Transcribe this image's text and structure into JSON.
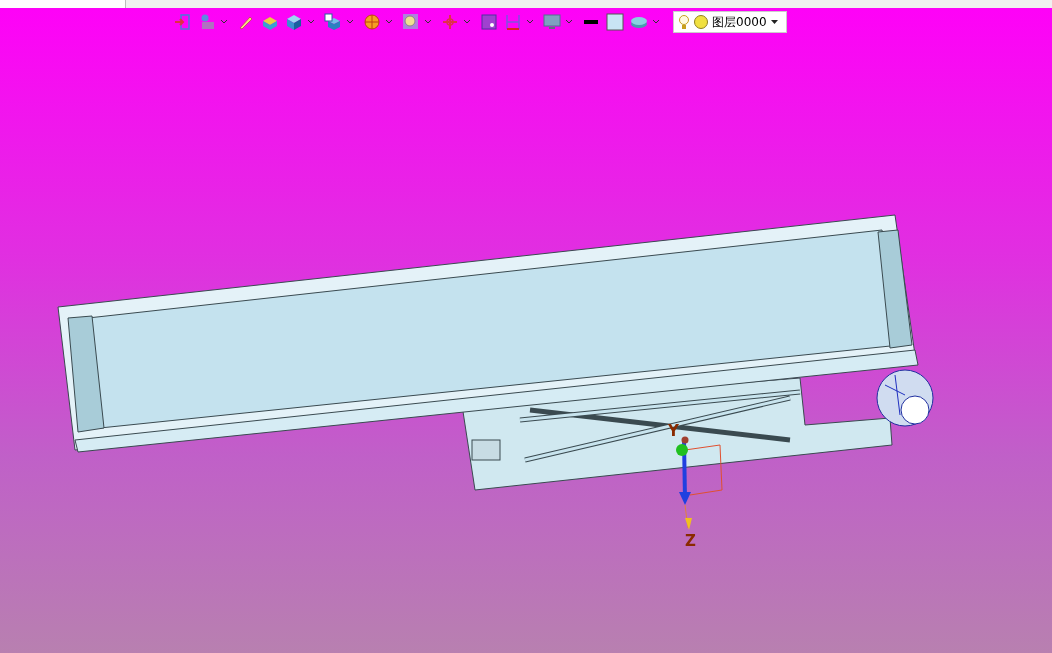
{
  "toolbar": [
    {
      "kind": "exit",
      "dropdown": false
    },
    {
      "kind": "sketch",
      "dropdown": true
    },
    {
      "kind": "pencil",
      "dropdown": false
    },
    {
      "kind": "box",
      "dropdown": false
    },
    {
      "kind": "cube",
      "dropdown": true
    },
    {
      "kind": "view",
      "dropdown": true
    },
    {
      "kind": "render",
      "dropdown": true
    },
    {
      "kind": "zoom",
      "dropdown": true
    },
    {
      "kind": "cross",
      "dropdown": true
    },
    {
      "kind": "frame",
      "dropdown": false
    },
    {
      "kind": "dimension",
      "dropdown": true
    },
    {
      "kind": "monitor",
      "dropdown": true
    },
    {
      "kind": "line",
      "dropdown": false
    },
    {
      "kind": "fill",
      "dropdown": false
    },
    {
      "kind": "layers",
      "dropdown": true
    }
  ],
  "layer_select": {
    "value": "图层0000"
  },
  "axes": {
    "y_label": "Y",
    "z_label": "Z"
  }
}
